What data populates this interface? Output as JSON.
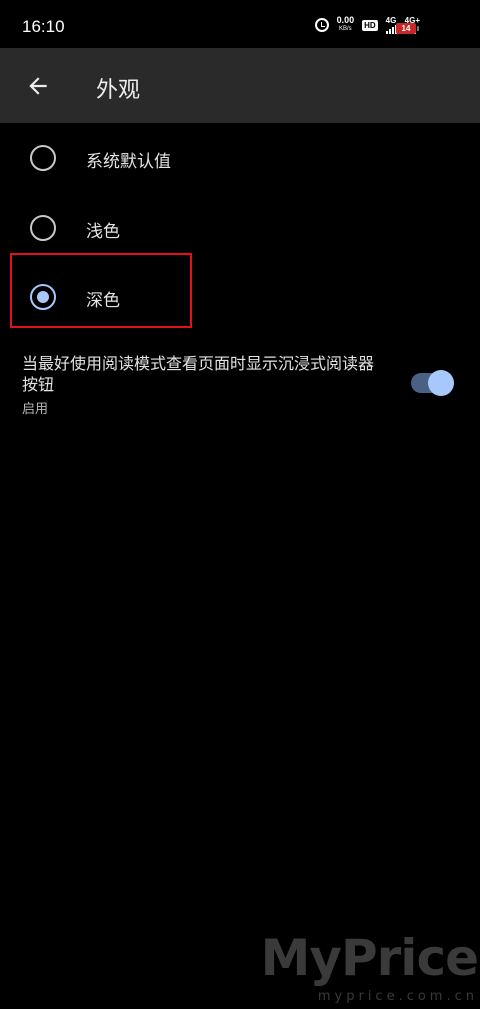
{
  "status_bar": {
    "time": "16:10",
    "net_speed_value": "0.00",
    "net_speed_unit": "KB/s",
    "hd_badge": "HD",
    "signal_1": "4G",
    "signal_2": "4G+",
    "battery_level": "14"
  },
  "app_bar": {
    "back_icon": "arrow-left-icon",
    "title": "外观"
  },
  "theme_options": [
    {
      "label": "系统默认值",
      "selected": false
    },
    {
      "label": "浅色",
      "selected": false
    },
    {
      "label": "深色",
      "selected": true
    }
  ],
  "reader_mode_setting": {
    "title": "当最好使用阅读模式查看页面时显示沉浸式阅读器按钮",
    "subtitle": "启用",
    "enabled": true
  },
  "watermark": {
    "logo": "MyPrice",
    "url": "myprice.com.cn"
  },
  "colors": {
    "background": "#000000",
    "app_bar": "#2a2a2a",
    "accent": "#a8c7fa",
    "highlight_box": "#e3101c"
  }
}
